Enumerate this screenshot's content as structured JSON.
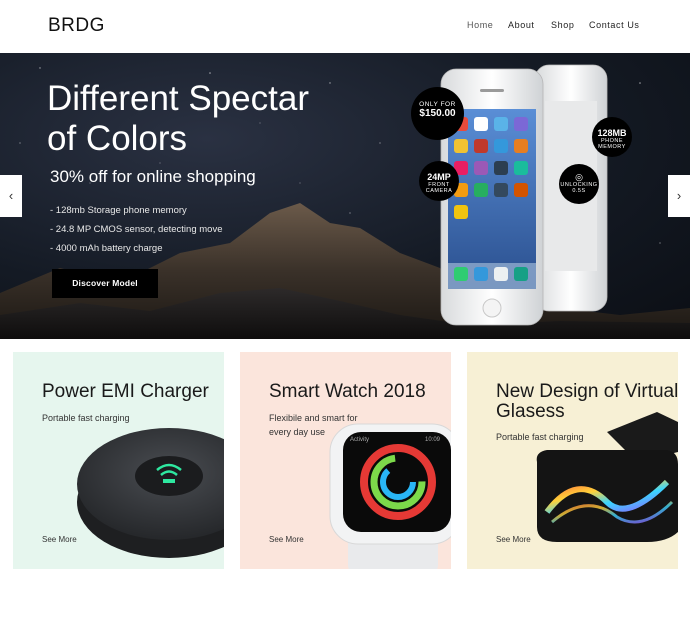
{
  "header": {
    "logo": "BRDG",
    "nav": [
      "Home",
      "About",
      "Shop",
      "Contact Us"
    ]
  },
  "hero": {
    "title": "Different Spectar of Colors",
    "subtitle": "30% off for online shopping",
    "features": [
      "- 128mb Storage phone memory",
      "- 24.8 MP CMOS sensor, detecting move",
      "- 4000 mAh battery charge"
    ],
    "cta_label": "Discover Model",
    "prev_arrow": "‹",
    "next_arrow": "›",
    "badges": {
      "price_small": "ONLY FOR",
      "price_big": "$150.00",
      "memory_big": "128MB",
      "memory_small": "PHONE MEMORY",
      "camera_big": "24MP",
      "camera_small": "FRONT CAMERA",
      "unlock_small": "UNLOCKING 0.5S"
    }
  },
  "cards": [
    {
      "title": "Power EMI Charger",
      "text": "Portable fast charging",
      "link": "See More"
    },
    {
      "title": "Smart Watch 2018",
      "text": "Flexibile and smart for every day use",
      "link": "See More"
    },
    {
      "title": "New Design of Virtual Glasess",
      "text": "Portable fast charging",
      "link": "See More"
    }
  ],
  "colors": {
    "card1_bg": "#e6f6ee",
    "card2_bg": "#fbe5dc",
    "card3_bg": "#f7f0d5",
    "cta_bg": "#000000"
  }
}
